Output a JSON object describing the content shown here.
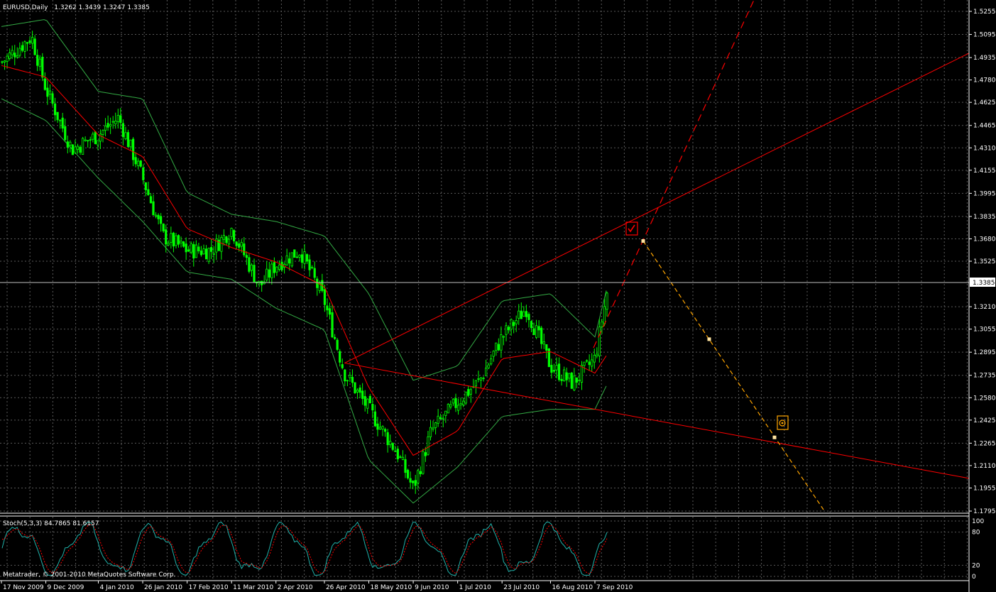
{
  "main_header": {
    "symbol": "EURUSD,Daily",
    "ohlc": "1.3262 1.3439 1.3247 1.3385"
  },
  "price_axis": {
    "labels": [
      "1.5255",
      "1.5095",
      "1.4935",
      "1.4780",
      "1.4625",
      "1.4465",
      "1.4310",
      "1.4155",
      "1.3995",
      "1.3835",
      "1.3680",
      "1.3525",
      "1.3210",
      "1.3055",
      "1.2895",
      "1.2735",
      "1.2580",
      "1.2425",
      "1.2265",
      "1.2110",
      "1.1955",
      "1.1795"
    ],
    "current_price": "1.3385"
  },
  "time_axis": {
    "labels": [
      "17 Nov 2009",
      "9 Dec 2009",
      "4 Jan 2010",
      "26 Jan 2010",
      "17 Feb 2010",
      "11 Mar 2010",
      "2 Apr 2010",
      "26 Apr 2010",
      "18 May 2010",
      "9 Jun 2010",
      "1 Jul 2010",
      "23 Jul 2010",
      "16 Aug 2010",
      "7 Sep 2010"
    ]
  },
  "stoch_panel": {
    "title": "Stoch(5,3,3) 84.7865 81.6157",
    "axis_labels": [
      "100",
      "80",
      "20",
      "0"
    ]
  },
  "copyright": "Metatrader, © 2001-2010 MetaQuotes Software Corp.",
  "colors": {
    "background": "#000000",
    "bull_candle": "#00ff00",
    "moving_average": "#ff0000",
    "bollinger": "#33aa44",
    "trend_line": "#ff0000",
    "projection": "#ffa500",
    "stoch_main": "#20b2aa",
    "stoch_signal": "#ff0000"
  },
  "icons": {
    "checkmark_marker": "check-icon",
    "target_marker": "target-icon"
  },
  "chart_data": {
    "type": "candlestick",
    "symbol": "EURUSD",
    "timeframe": "Daily",
    "ylim": [
      1.1795,
      1.5255
    ],
    "last": {
      "open": 1.3262,
      "high": 1.3439,
      "low": 1.3247,
      "close": 1.3385
    },
    "close_path": [
      {
        "date": "17 Nov 2009",
        "close": 1.49
      },
      {
        "date": "2 Dec 2009",
        "close": 1.508
      },
      {
        "date": "9 Dec 2009",
        "close": 1.472
      },
      {
        "date": "22 Dec 2009",
        "close": 1.43
      },
      {
        "date": "4 Jan 2010",
        "close": 1.44
      },
      {
        "date": "14 Jan 2010",
        "close": 1.452
      },
      {
        "date": "26 Jan 2010",
        "close": 1.41
      },
      {
        "date": "5 Feb 2010",
        "close": 1.37
      },
      {
        "date": "17 Feb 2010",
        "close": 1.36
      },
      {
        "date": "1 Mar 2010",
        "close": 1.36
      },
      {
        "date": "11 Mar 2010",
        "close": 1.375
      },
      {
        "date": "25 Mar 2010",
        "close": 1.335
      },
      {
        "date": "2 Apr 2010",
        "close": 1.35
      },
      {
        "date": "14 Apr 2010",
        "close": 1.36
      },
      {
        "date": "26 Apr 2010",
        "close": 1.325
      },
      {
        "date": "6 May 2010",
        "close": 1.275
      },
      {
        "date": "18 May 2010",
        "close": 1.25
      },
      {
        "date": "1 Jun 2010",
        "close": 1.22
      },
      {
        "date": "9 Jun 2010",
        "close": 1.195
      },
      {
        "date": "18 Jun 2010",
        "close": 1.235
      },
      {
        "date": "1 Jul 2010",
        "close": 1.255
      },
      {
        "date": "12 Jul 2010",
        "close": 1.27
      },
      {
        "date": "23 Jul 2010",
        "close": 1.3
      },
      {
        "date": "4 Aug 2010",
        "close": 1.32
      },
      {
        "date": "16 Aug 2010",
        "close": 1.28
      },
      {
        "date": "27 Aug 2010",
        "close": 1.268
      },
      {
        "date": "7 Sep 2010",
        "close": 1.285
      },
      {
        "date": "14 Sep 2010",
        "close": 1.3385
      }
    ],
    "moving_average": [
      {
        "date": "17 Nov 2009",
        "value": 1.488
      },
      {
        "date": "9 Dec 2009",
        "value": 1.48
      },
      {
        "date": "4 Jan 2010",
        "value": 1.44
      },
      {
        "date": "26 Jan 2010",
        "value": 1.425
      },
      {
        "date": "17 Feb 2010",
        "value": 1.375
      },
      {
        "date": "11 Mar 2010",
        "value": 1.362
      },
      {
        "date": "2 Apr 2010",
        "value": 1.352
      },
      {
        "date": "26 Apr 2010",
        "value": 1.335
      },
      {
        "date": "18 May 2010",
        "value": 1.265
      },
      {
        "date": "9 Jun 2010",
        "value": 1.218
      },
      {
        "date": "1 Jul 2010",
        "value": 1.235
      },
      {
        "date": "23 Jul 2010",
        "value": 1.285
      },
      {
        "date": "16 Aug 2010",
        "value": 1.29
      },
      {
        "date": "7 Sep 2010",
        "value": 1.275
      },
      {
        "date": "14 Sep 2010",
        "value": 1.29
      }
    ],
    "bollinger_upper": [
      {
        "date": "17 Nov 2009",
        "value": 1.515
      },
      {
        "date": "9 Dec 2009",
        "value": 1.52
      },
      {
        "date": "4 Jan 2010",
        "value": 1.47
      },
      {
        "date": "26 Jan 2010",
        "value": 1.465
      },
      {
        "date": "17 Feb 2010",
        "value": 1.4
      },
      {
        "date": "11 Mar 2010",
        "value": 1.385
      },
      {
        "date": "2 Apr 2010",
        "value": 1.38
      },
      {
        "date": "26 Apr 2010",
        "value": 1.37
      },
      {
        "date": "18 May 2010",
        "value": 1.33
      },
      {
        "date": "9 Jun 2010",
        "value": 1.27
      },
      {
        "date": "1 Jul 2010",
        "value": 1.28
      },
      {
        "date": "23 Jul 2010",
        "value": 1.325
      },
      {
        "date": "16 Aug 2010",
        "value": 1.33
      },
      {
        "date": "7 Sep 2010",
        "value": 1.3
      },
      {
        "date": "14 Sep 2010",
        "value": 1.34
      }
    ],
    "bollinger_lower": [
      {
        "date": "17 Nov 2009",
        "value": 1.465
      },
      {
        "date": "9 Dec 2009",
        "value": 1.45
      },
      {
        "date": "4 Jan 2010",
        "value": 1.41
      },
      {
        "date": "26 Jan 2010",
        "value": 1.38
      },
      {
        "date": "17 Feb 2010",
        "value": 1.345
      },
      {
        "date": "11 Mar 2010",
        "value": 1.34
      },
      {
        "date": "2 Apr 2010",
        "value": 1.32
      },
      {
        "date": "26 Apr 2010",
        "value": 1.305
      },
      {
        "date": "18 May 2010",
        "value": 1.215
      },
      {
        "date": "9 Jun 2010",
        "value": 1.185
      },
      {
        "date": "1 Jul 2010",
        "value": 1.21
      },
      {
        "date": "23 Jul 2010",
        "value": 1.245
      },
      {
        "date": "16 Aug 2010",
        "value": 1.25
      },
      {
        "date": "7 Sep 2010",
        "value": 1.25
      },
      {
        "date": "14 Sep 2010",
        "value": 1.27
      }
    ],
    "trend_lines": [
      {
        "from": {
          "date": "6 May 2010",
          "price": 1.282
        },
        "to": {
          "date": "7 Sep 2010",
          "price": 1.368
        }
      },
      {
        "from": {
          "date": "6 May 2010",
          "price": 1.282
        },
        "to": {
          "date": "7 Sep 2010",
          "price": 1.25
        }
      }
    ],
    "projection_points": [
      1.3665,
      1.2985,
      1.2305
    ]
  }
}
